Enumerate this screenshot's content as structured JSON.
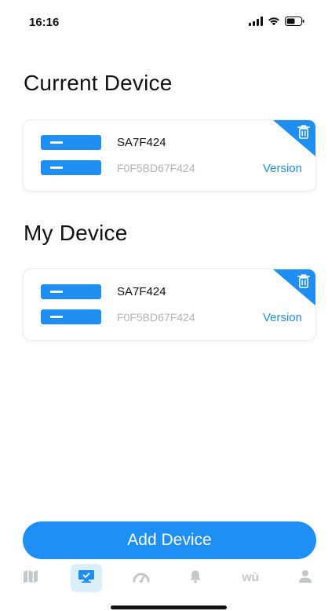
{
  "status_bar": {
    "time": "16:16"
  },
  "sections": {
    "current_title": "Current Device",
    "my_title": "My Device"
  },
  "current_device": {
    "name": "SA7F424",
    "mac": "F0F5BD67F424",
    "version_label": "Version"
  },
  "my_device": {
    "name": "SA7F424",
    "mac": "F0F5BD67F424",
    "version_label": "Version"
  },
  "add_button": {
    "label": "Add Device"
  },
  "tabs": [
    {
      "icon": "map-icon",
      "active": false
    },
    {
      "icon": "device-icon",
      "active": true
    },
    {
      "icon": "gauge-icon",
      "active": false
    },
    {
      "icon": "bell-icon",
      "active": false
    },
    {
      "icon": "wu-icon",
      "label": "wù",
      "active": false
    },
    {
      "icon": "user-icon",
      "active": false
    }
  ],
  "colors": {
    "accent": "#1e8ef0",
    "muted_text": "#b3b3b3",
    "tab_inactive": "#c4c8cc",
    "tab_active_bg": "#dbeefc"
  }
}
